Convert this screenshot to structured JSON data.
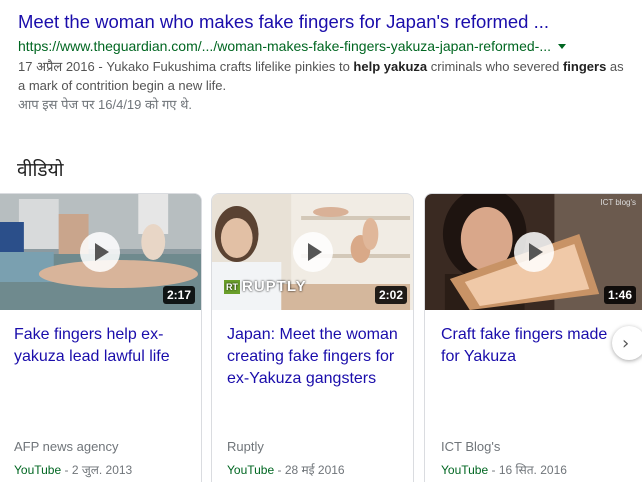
{
  "result": {
    "title": "Meet the woman who makes fake fingers for Japan's reformed ...",
    "url": "https://www.theguardian.com/.../woman-makes-fake-fingers-yakuza-japan-reformed-...",
    "snippet_date": "17 अप्रैल 2016 - ",
    "snippet_1": "Yukako Fukushima crafts lifelike pinkies to ",
    "snippet_bold_1": "help yakuza",
    "snippet_2": " criminals who severed ",
    "snippet_bold_2": "fingers",
    "snippet_3": " as a mark of contrition begin a new life.",
    "visited": "आप इस पेज पर 16/4/19 को गए थे."
  },
  "videos_section": {
    "title": "वीडियो",
    "cards": [
      {
        "title": "Fake fingers help ex-yakuza lead lawful life",
        "duration": "2:17",
        "source": "AFP news agency",
        "platform": "YouTube",
        "date": " - 2 जुल. 2013"
      },
      {
        "title": "Japan: Meet the woman creating fake fingers for ex-Yakuza gangsters",
        "duration": "2:02",
        "source": "Ruptly",
        "platform": "YouTube",
        "date": " - 28 मई 2016",
        "watermark_rt": "RT",
        "watermark": "RUPTLY"
      },
      {
        "title": "Craft fake fingers made for Yakuza",
        "duration": "1:46",
        "source": "ICT Blog's",
        "platform": "YouTube",
        "date": " - 16 सित. 2016",
        "watermark": "ICT blog's"
      }
    ],
    "next_icon": "›"
  },
  "colors": {
    "link": "#1a0dab",
    "url_green": "#006621",
    "snippet": "#545454",
    "muted": "#70757a"
  },
  "icons": [
    "play-icon",
    "chevron-down-icon",
    "chevron-right-icon"
  ]
}
